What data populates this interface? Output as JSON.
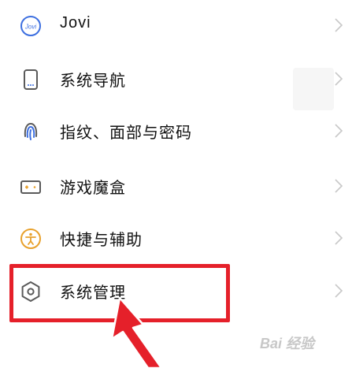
{
  "settings": {
    "items": [
      {
        "label": "Jovi",
        "icon": "jovi-icon"
      },
      {
        "label": "系统导航",
        "icon": "phone-navigation-icon"
      },
      {
        "label": "指纹、面部与密码",
        "icon": "fingerprint-icon"
      },
      {
        "label": "游戏魔盒",
        "icon": "game-box-icon"
      },
      {
        "label": "快捷与辅助",
        "icon": "accessibility-icon"
      },
      {
        "label": "系统管理",
        "icon": "system-management-icon"
      }
    ]
  },
  "colors": {
    "icon_blue": "#3d6fe0",
    "icon_orange": "#e8a12c",
    "icon_gray": "#5a5a5a",
    "chevron": "#c8c8c8",
    "annotation_red": "#e5202a"
  },
  "watermark": {
    "text": "Bai 经验"
  }
}
